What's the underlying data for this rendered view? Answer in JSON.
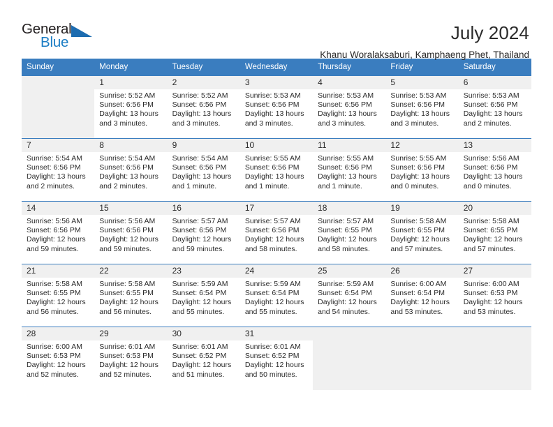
{
  "brand": {
    "name_dark": "General",
    "name_blue": "Blue",
    "accent_color": "#1d6cb0",
    "triangle_icon": "triangle-icon"
  },
  "header": {
    "title": "July 2024",
    "subtitle": "Khanu Woralaksaburi, Kamphaeng Phet, Thailand"
  },
  "calendar": {
    "header_bg": "#3a7dbf",
    "daynum_bg": "#f0f0f0",
    "weekday_headers": [
      "Sunday",
      "Monday",
      "Tuesday",
      "Wednesday",
      "Thursday",
      "Friday",
      "Saturday"
    ],
    "weeks": [
      [
        {
          "day": "",
          "empty": true,
          "sunrise": "",
          "sunset": "",
          "daylight1": "",
          "daylight2": ""
        },
        {
          "day": "1",
          "sunrise": "Sunrise: 5:52 AM",
          "sunset": "Sunset: 6:56 PM",
          "daylight1": "Daylight: 13 hours",
          "daylight2": "and 3 minutes."
        },
        {
          "day": "2",
          "sunrise": "Sunrise: 5:52 AM",
          "sunset": "Sunset: 6:56 PM",
          "daylight1": "Daylight: 13 hours",
          "daylight2": "and 3 minutes."
        },
        {
          "day": "3",
          "sunrise": "Sunrise: 5:53 AM",
          "sunset": "Sunset: 6:56 PM",
          "daylight1": "Daylight: 13 hours",
          "daylight2": "and 3 minutes."
        },
        {
          "day": "4",
          "sunrise": "Sunrise: 5:53 AM",
          "sunset": "Sunset: 6:56 PM",
          "daylight1": "Daylight: 13 hours",
          "daylight2": "and 3 minutes."
        },
        {
          "day": "5",
          "sunrise": "Sunrise: 5:53 AM",
          "sunset": "Sunset: 6:56 PM",
          "daylight1": "Daylight: 13 hours",
          "daylight2": "and 3 minutes."
        },
        {
          "day": "6",
          "sunrise": "Sunrise: 5:53 AM",
          "sunset": "Sunset: 6:56 PM",
          "daylight1": "Daylight: 13 hours",
          "daylight2": "and 2 minutes."
        }
      ],
      [
        {
          "day": "7",
          "sunrise": "Sunrise: 5:54 AM",
          "sunset": "Sunset: 6:56 PM",
          "daylight1": "Daylight: 13 hours",
          "daylight2": "and 2 minutes."
        },
        {
          "day": "8",
          "sunrise": "Sunrise: 5:54 AM",
          "sunset": "Sunset: 6:56 PM",
          "daylight1": "Daylight: 13 hours",
          "daylight2": "and 2 minutes."
        },
        {
          "day": "9",
          "sunrise": "Sunrise: 5:54 AM",
          "sunset": "Sunset: 6:56 PM",
          "daylight1": "Daylight: 13 hours",
          "daylight2": "and 1 minute."
        },
        {
          "day": "10",
          "sunrise": "Sunrise: 5:55 AM",
          "sunset": "Sunset: 6:56 PM",
          "daylight1": "Daylight: 13 hours",
          "daylight2": "and 1 minute."
        },
        {
          "day": "11",
          "sunrise": "Sunrise: 5:55 AM",
          "sunset": "Sunset: 6:56 PM",
          "daylight1": "Daylight: 13 hours",
          "daylight2": "and 1 minute."
        },
        {
          "day": "12",
          "sunrise": "Sunrise: 5:55 AM",
          "sunset": "Sunset: 6:56 PM",
          "daylight1": "Daylight: 13 hours",
          "daylight2": "and 0 minutes."
        },
        {
          "day": "13",
          "sunrise": "Sunrise: 5:56 AM",
          "sunset": "Sunset: 6:56 PM",
          "daylight1": "Daylight: 13 hours",
          "daylight2": "and 0 minutes."
        }
      ],
      [
        {
          "day": "14",
          "sunrise": "Sunrise: 5:56 AM",
          "sunset": "Sunset: 6:56 PM",
          "daylight1": "Daylight: 12 hours",
          "daylight2": "and 59 minutes."
        },
        {
          "day": "15",
          "sunrise": "Sunrise: 5:56 AM",
          "sunset": "Sunset: 6:56 PM",
          "daylight1": "Daylight: 12 hours",
          "daylight2": "and 59 minutes."
        },
        {
          "day": "16",
          "sunrise": "Sunrise: 5:57 AM",
          "sunset": "Sunset: 6:56 PM",
          "daylight1": "Daylight: 12 hours",
          "daylight2": "and 59 minutes."
        },
        {
          "day": "17",
          "sunrise": "Sunrise: 5:57 AM",
          "sunset": "Sunset: 6:56 PM",
          "daylight1": "Daylight: 12 hours",
          "daylight2": "and 58 minutes."
        },
        {
          "day": "18",
          "sunrise": "Sunrise: 5:57 AM",
          "sunset": "Sunset: 6:55 PM",
          "daylight1": "Daylight: 12 hours",
          "daylight2": "and 58 minutes."
        },
        {
          "day": "19",
          "sunrise": "Sunrise: 5:58 AM",
          "sunset": "Sunset: 6:55 PM",
          "daylight1": "Daylight: 12 hours",
          "daylight2": "and 57 minutes."
        },
        {
          "day": "20",
          "sunrise": "Sunrise: 5:58 AM",
          "sunset": "Sunset: 6:55 PM",
          "daylight1": "Daylight: 12 hours",
          "daylight2": "and 57 minutes."
        }
      ],
      [
        {
          "day": "21",
          "sunrise": "Sunrise: 5:58 AM",
          "sunset": "Sunset: 6:55 PM",
          "daylight1": "Daylight: 12 hours",
          "daylight2": "and 56 minutes."
        },
        {
          "day": "22",
          "sunrise": "Sunrise: 5:58 AM",
          "sunset": "Sunset: 6:55 PM",
          "daylight1": "Daylight: 12 hours",
          "daylight2": "and 56 minutes."
        },
        {
          "day": "23",
          "sunrise": "Sunrise: 5:59 AM",
          "sunset": "Sunset: 6:54 PM",
          "daylight1": "Daylight: 12 hours",
          "daylight2": "and 55 minutes."
        },
        {
          "day": "24",
          "sunrise": "Sunrise: 5:59 AM",
          "sunset": "Sunset: 6:54 PM",
          "daylight1": "Daylight: 12 hours",
          "daylight2": "and 55 minutes."
        },
        {
          "day": "25",
          "sunrise": "Sunrise: 5:59 AM",
          "sunset": "Sunset: 6:54 PM",
          "daylight1": "Daylight: 12 hours",
          "daylight2": "and 54 minutes."
        },
        {
          "day": "26",
          "sunrise": "Sunrise: 6:00 AM",
          "sunset": "Sunset: 6:54 PM",
          "daylight1": "Daylight: 12 hours",
          "daylight2": "and 53 minutes."
        },
        {
          "day": "27",
          "sunrise": "Sunrise: 6:00 AM",
          "sunset": "Sunset: 6:53 PM",
          "daylight1": "Daylight: 12 hours",
          "daylight2": "and 53 minutes."
        }
      ],
      [
        {
          "day": "28",
          "sunrise": "Sunrise: 6:00 AM",
          "sunset": "Sunset: 6:53 PM",
          "daylight1": "Daylight: 12 hours",
          "daylight2": "and 52 minutes."
        },
        {
          "day": "29",
          "sunrise": "Sunrise: 6:01 AM",
          "sunset": "Sunset: 6:53 PM",
          "daylight1": "Daylight: 12 hours",
          "daylight2": "and 52 minutes."
        },
        {
          "day": "30",
          "sunrise": "Sunrise: 6:01 AM",
          "sunset": "Sunset: 6:52 PM",
          "daylight1": "Daylight: 12 hours",
          "daylight2": "and 51 minutes."
        },
        {
          "day": "31",
          "sunrise": "Sunrise: 6:01 AM",
          "sunset": "Sunset: 6:52 PM",
          "daylight1": "Daylight: 12 hours",
          "daylight2": "and 50 minutes."
        },
        {
          "day": "",
          "empty": true,
          "sunrise": "",
          "sunset": "",
          "daylight1": "",
          "daylight2": ""
        },
        {
          "day": "",
          "empty": true,
          "sunrise": "",
          "sunset": "",
          "daylight1": "",
          "daylight2": ""
        },
        {
          "day": "",
          "empty": true,
          "sunrise": "",
          "sunset": "",
          "daylight1": "",
          "daylight2": ""
        }
      ]
    ]
  }
}
